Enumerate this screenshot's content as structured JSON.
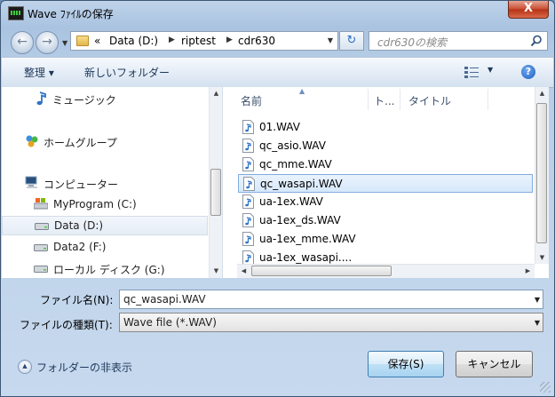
{
  "window": {
    "title": "Wave ﾌｧｲﾙの保存",
    "close_glyph": "X"
  },
  "address": {
    "overflow": "«",
    "breadcrumbs": [
      "Data (D:)",
      "riptest",
      "cdr630"
    ]
  },
  "search": {
    "placeholder": "cdr630の検索"
  },
  "toolbar": {
    "organize_label": "整理 ▾",
    "new_folder_label": "新しいフォルダー"
  },
  "navpane": {
    "items": [
      {
        "label": "ミュージック",
        "icon": "music-note-icon"
      },
      {
        "label": "ホームグループ",
        "icon": "homegroup-icon"
      },
      {
        "label": "コンピューター",
        "icon": "computer-icon"
      },
      {
        "label": "MyProgram (C:)",
        "icon": "system-drive-icon"
      },
      {
        "label": "Data (D:)",
        "icon": "drive-icon",
        "selected": true
      },
      {
        "label": "Data2 (F:)",
        "icon": "drive-icon"
      },
      {
        "label": "ローカル ディスク (G:)",
        "icon": "drive-icon"
      }
    ]
  },
  "filelist": {
    "columns": [
      "名前",
      "ト...",
      "タイトル"
    ],
    "files": [
      {
        "name": "01.WAV"
      },
      {
        "name": "qc_asio.WAV"
      },
      {
        "name": "qc_mme.WAV"
      },
      {
        "name": "qc_wasapi.WAV",
        "selected": true
      },
      {
        "name": "ua-1ex.WAV"
      },
      {
        "name": "ua-1ex_ds.WAV"
      },
      {
        "name": "ua-1ex_mme.WAV"
      },
      {
        "name": "ua-1ex_wasapi...."
      }
    ]
  },
  "form": {
    "filename_label": "ファイル名(N):",
    "filename_value": "qc_wasapi.WAV",
    "filetype_label": "ファイルの種類(T):",
    "filetype_value": "Wave file (*.WAV)"
  },
  "footer": {
    "hide_folders_label": "フォルダーの非表示",
    "save_label": "保存(S)",
    "cancel_label": "キャンセル"
  },
  "colors": {
    "accent": "#3c7fb1",
    "selection": "#d7e8fb"
  }
}
